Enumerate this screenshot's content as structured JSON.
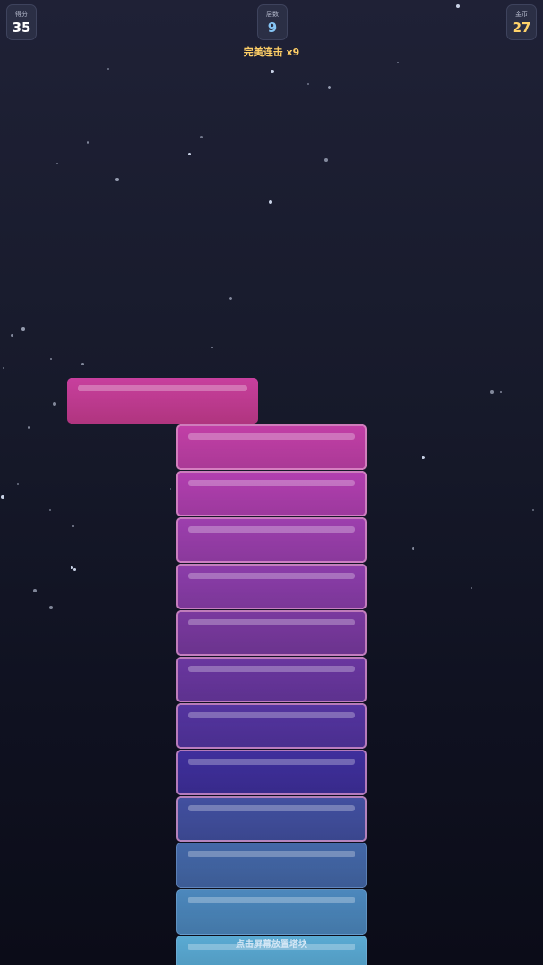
{
  "hud": {
    "score": {
      "label": "得分",
      "value": "35"
    },
    "floors": {
      "label": "层数",
      "value": "9"
    },
    "coins": {
      "label": "金币",
      "value": "27"
    }
  },
  "combo_text": "完美连击 x9",
  "hint_text": "点击屏幕放置塔块",
  "colors": {
    "moving_block": "#c83f9e",
    "stack_top_to_bottom": [
      "#c23fa7",
      "#b23fb0",
      "#9d3fae",
      "#8c3daa",
      "#7a399f",
      "#6a37a0",
      "#5434a0",
      "#3f2f9c",
      "#4250a0",
      "#4468a8",
      "#4c88bd",
      "#5aaad3"
    ],
    "combo": "#ffcf66",
    "floors_value": "#86c5f5",
    "coins_value": "#ffd36a"
  }
}
